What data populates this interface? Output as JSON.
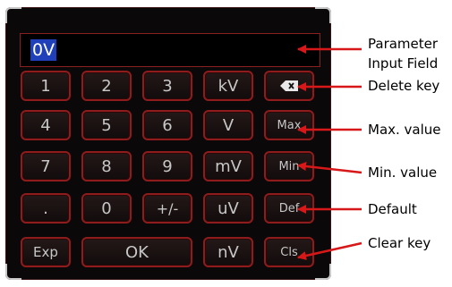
{
  "input": {
    "value": "0V"
  },
  "keys": {
    "k1": "1",
    "k2": "2",
    "k3": "3",
    "kv": "kV",
    "k4": "4",
    "k5": "5",
    "k6": "6",
    "v": "V",
    "max": "Max",
    "k7": "7",
    "k8": "8",
    "k9": "9",
    "mv": "mV",
    "min": "Min",
    "dot": ".",
    "k0": "0",
    "sign": "+/-",
    "uv": "uV",
    "def": "Def",
    "exp": "Exp",
    "ok": "OK",
    "nv": "nV",
    "cls": "Cls"
  },
  "annotations": {
    "param_line1": "Parameter",
    "param_line2": "Input Field",
    "delete": "Delete key",
    "max": "Max. value",
    "min": "Min. value",
    "default": "Default",
    "clear": "Clear key"
  },
  "icons": {
    "delete": "backspace-icon"
  },
  "colors": {
    "key_border": "#8e1c1c",
    "input_highlight": "#1f40b8",
    "arrow": "#d81818"
  }
}
